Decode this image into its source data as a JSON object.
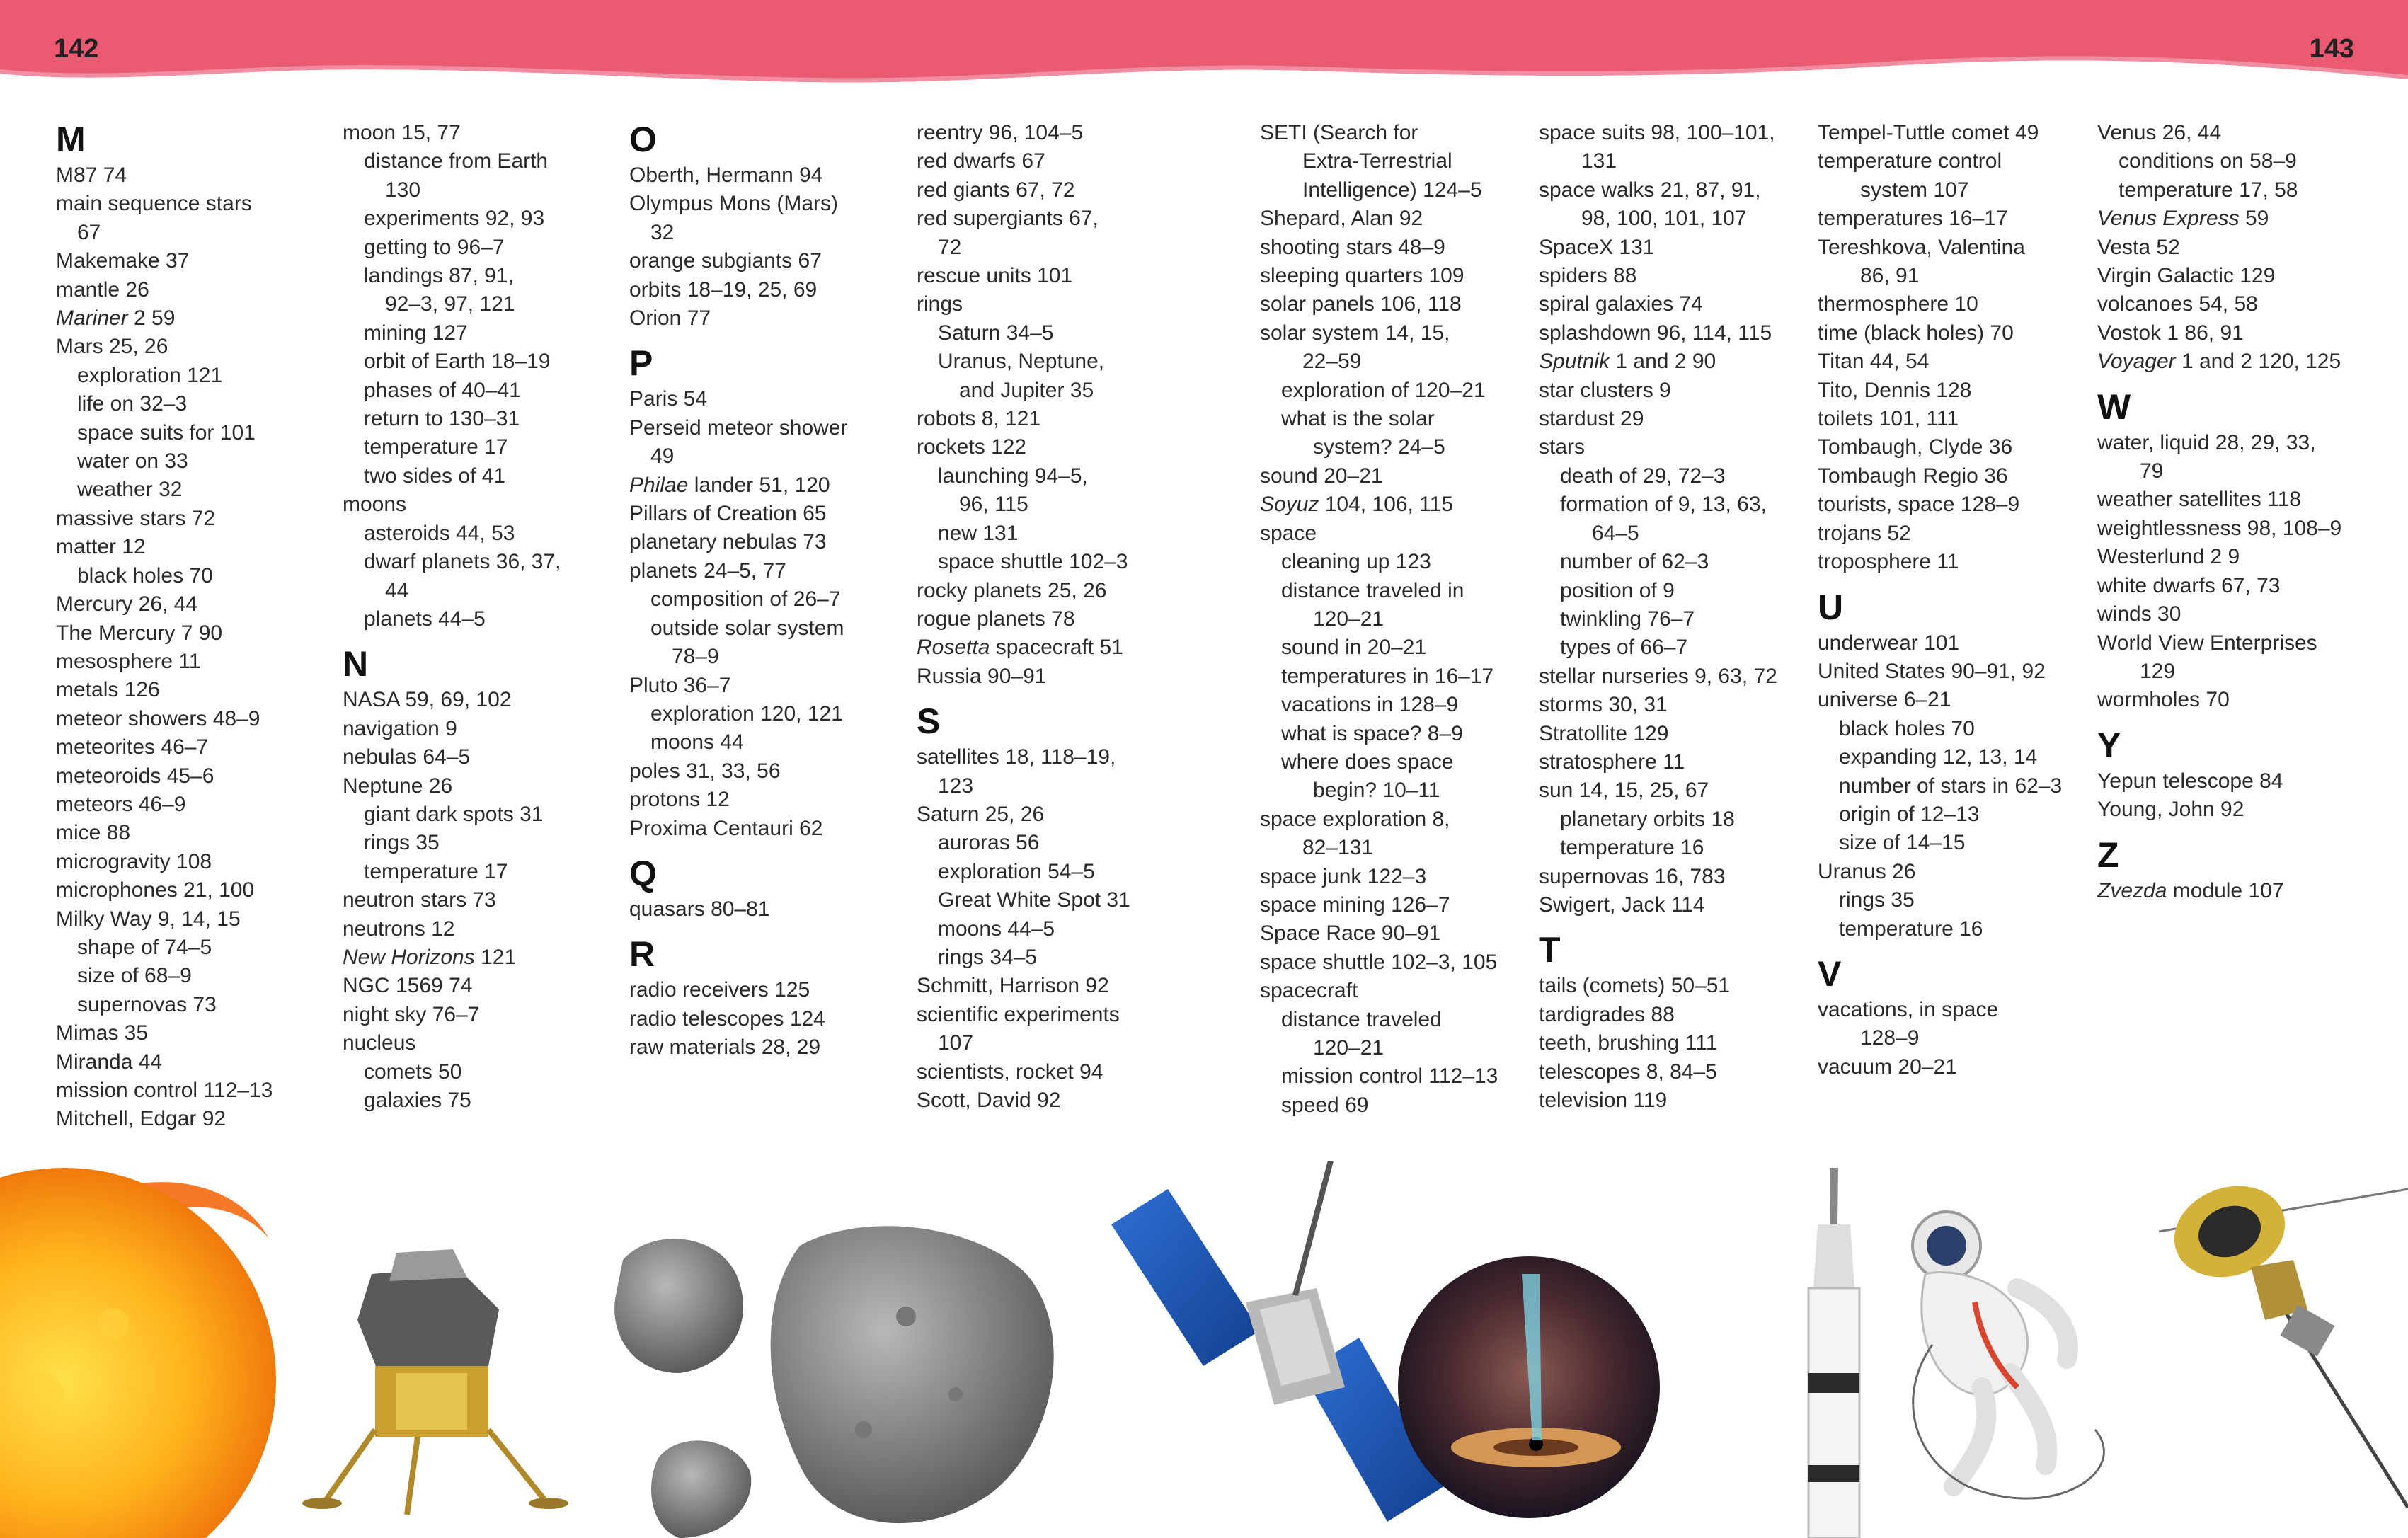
{
  "page_numbers": {
    "left": "142",
    "right": "143"
  },
  "colors": {
    "banner": "#EB5A73",
    "banner_light": "#F08DA0",
    "text": "#2a2a2a"
  },
  "columns": [
    [
      {
        "t": "h",
        "v": "M"
      },
      {
        "t": "e",
        "v": "M87 74"
      },
      {
        "t": "e",
        "v": "main sequence stars"
      },
      {
        "t": "c",
        "v": "67",
        "l": 2
      },
      {
        "t": "e",
        "v": "Makemake 37"
      },
      {
        "t": "e",
        "v": "mantle 26"
      },
      {
        "t": "e",
        "v": [
          [
            "Mariner",
            true
          ],
          [
            " 2 59",
            false
          ]
        ]
      },
      {
        "t": "e",
        "v": "Mars 25, 26"
      },
      {
        "t": "s",
        "v": "exploration 121"
      },
      {
        "t": "s",
        "v": "life on 32–3"
      },
      {
        "t": "s",
        "v": "space suits for 101"
      },
      {
        "t": "s",
        "v": "water on 33"
      },
      {
        "t": "s",
        "v": "weather 32"
      },
      {
        "t": "e",
        "v": "massive stars 72"
      },
      {
        "t": "e",
        "v": "matter 12"
      },
      {
        "t": "s",
        "v": "black holes 70"
      },
      {
        "t": "e",
        "v": "Mercury 26, 44"
      },
      {
        "t": "e",
        "v": "The Mercury 7 90"
      },
      {
        "t": "e",
        "v": "mesosphere 11"
      },
      {
        "t": "e",
        "v": "metals 126"
      },
      {
        "t": "e",
        "v": "meteor showers 48–9"
      },
      {
        "t": "e",
        "v": "meteorites 46–7"
      },
      {
        "t": "e",
        "v": "meteoroids 45–6"
      },
      {
        "t": "e",
        "v": "meteors 46–9"
      },
      {
        "t": "e",
        "v": "mice 88"
      },
      {
        "t": "e",
        "v": "microgravity 108"
      },
      {
        "t": "e",
        "v": "microphones 21, 100"
      },
      {
        "t": "e",
        "v": "Milky Way 9, 14, 15"
      },
      {
        "t": "s",
        "v": "shape of 74–5"
      },
      {
        "t": "s",
        "v": "size of 68–9"
      },
      {
        "t": "s",
        "v": "supernovas 73"
      },
      {
        "t": "e",
        "v": "Mimas 35"
      },
      {
        "t": "e",
        "v": "Miranda 44"
      },
      {
        "t": "e",
        "v": "mission control 112–13"
      },
      {
        "t": "e",
        "v": "Mitchell, Edgar 92"
      }
    ],
    [
      {
        "t": "e",
        "v": "moon 15, 77"
      },
      {
        "t": "s",
        "v": "distance from Earth"
      },
      {
        "t": "c",
        "v": "130",
        "l": 3
      },
      {
        "t": "s",
        "v": "experiments 92, 93"
      },
      {
        "t": "s",
        "v": "getting to 96–7"
      },
      {
        "t": "s",
        "v": "landings 87, 91,"
      },
      {
        "t": "c",
        "v": "92–3, 97, 121",
        "l": 3
      },
      {
        "t": "s",
        "v": "mining 127"
      },
      {
        "t": "s",
        "v": "orbit of Earth 18–19"
      },
      {
        "t": "s",
        "v": "phases of 40–41"
      },
      {
        "t": "s",
        "v": "return to 130–31"
      },
      {
        "t": "s",
        "v": "temperature 17"
      },
      {
        "t": "s",
        "v": "two sides of 41"
      },
      {
        "t": "e",
        "v": "moons"
      },
      {
        "t": "s",
        "v": "asteroids 44, 53"
      },
      {
        "t": "s",
        "v": "dwarf planets 36, 37,"
      },
      {
        "t": "c",
        "v": "44",
        "l": 3
      },
      {
        "t": "s",
        "v": "planets 44–5"
      },
      {
        "t": "h",
        "v": "N"
      },
      {
        "t": "e",
        "v": "NASA 59, 69, 102"
      },
      {
        "t": "e",
        "v": "navigation 9"
      },
      {
        "t": "e",
        "v": "nebulas 64–5"
      },
      {
        "t": "e",
        "v": "Neptune 26"
      },
      {
        "t": "s",
        "v": "giant dark spots 31"
      },
      {
        "t": "s",
        "v": "rings 35"
      },
      {
        "t": "s",
        "v": "temperature 17"
      },
      {
        "t": "e",
        "v": "neutron stars 73"
      },
      {
        "t": "e",
        "v": "neutrons 12"
      },
      {
        "t": "e",
        "v": [
          [
            "New Horizons",
            true
          ],
          [
            " 121",
            false
          ]
        ]
      },
      {
        "t": "e",
        "v": "NGC 1569 74"
      },
      {
        "t": "e",
        "v": "night sky 76–7"
      },
      {
        "t": "e",
        "v": "nucleus"
      },
      {
        "t": "s",
        "v": "comets 50"
      },
      {
        "t": "s",
        "v": "galaxies 75"
      }
    ],
    [
      {
        "t": "h",
        "v": "O"
      },
      {
        "t": "e",
        "v": "Oberth, Hermann 94"
      },
      {
        "t": "e",
        "v": "Olympus Mons (Mars)"
      },
      {
        "t": "c",
        "v": "32",
        "l": 2
      },
      {
        "t": "e",
        "v": "orange subgiants 67"
      },
      {
        "t": "e",
        "v": "orbits 18–19, 25, 69"
      },
      {
        "t": "e",
        "v": "Orion 77"
      },
      {
        "t": "h",
        "v": "P"
      },
      {
        "t": "e",
        "v": "Paris 54"
      },
      {
        "t": "e",
        "v": "Perseid meteor shower"
      },
      {
        "t": "c",
        "v": "49",
        "l": 2
      },
      {
        "t": "e",
        "v": [
          [
            "Philae",
            true
          ],
          [
            " lander 51, 120",
            false
          ]
        ]
      },
      {
        "t": "e",
        "v": "Pillars of Creation 65"
      },
      {
        "t": "e",
        "v": "planetary nebulas 73"
      },
      {
        "t": "e",
        "v": "planets 24–5, 77"
      },
      {
        "t": "s",
        "v": "composition of 26–7"
      },
      {
        "t": "s",
        "v": "outside solar system"
      },
      {
        "t": "c",
        "v": "78–9",
        "l": 3
      },
      {
        "t": "e",
        "v": "Pluto 36–7"
      },
      {
        "t": "s",
        "v": "exploration 120, 121"
      },
      {
        "t": "s",
        "v": "moons 44"
      },
      {
        "t": "e",
        "v": "poles 31, 33, 56"
      },
      {
        "t": "e",
        "v": "protons 12"
      },
      {
        "t": "e",
        "v": "Proxima Centauri 62"
      },
      {
        "t": "h",
        "v": "Q"
      },
      {
        "t": "e",
        "v": "quasars 80–81"
      },
      {
        "t": "h",
        "v": "R"
      },
      {
        "t": "e",
        "v": "radio receivers 125"
      },
      {
        "t": "e",
        "v": "radio telescopes 124"
      },
      {
        "t": "e",
        "v": "raw materials 28, 29"
      }
    ],
    [
      {
        "t": "e",
        "v": "reentry 96, 104–5"
      },
      {
        "t": "e",
        "v": "red dwarfs 67"
      },
      {
        "t": "e",
        "v": "red giants 67, 72"
      },
      {
        "t": "e",
        "v": "red supergiants 67,"
      },
      {
        "t": "c",
        "v": "72",
        "l": 2
      },
      {
        "t": "e",
        "v": "rescue units 101"
      },
      {
        "t": "e",
        "v": "rings"
      },
      {
        "t": "s",
        "v": "Saturn 34–5"
      },
      {
        "t": "s",
        "v": "Uranus, Neptune,"
      },
      {
        "t": "c",
        "v": "and Jupiter 35",
        "l": 3
      },
      {
        "t": "e",
        "v": "robots 8, 121"
      },
      {
        "t": "e",
        "v": "rockets 122"
      },
      {
        "t": "s",
        "v": "launching 94–5,"
      },
      {
        "t": "c",
        "v": "96, 115",
        "l": 3
      },
      {
        "t": "s",
        "v": "new 131"
      },
      {
        "t": "s",
        "v": "space shuttle 102–3"
      },
      {
        "t": "e",
        "v": "rocky planets 25, 26"
      },
      {
        "t": "e",
        "v": "rogue planets 78"
      },
      {
        "t": "e",
        "v": [
          [
            "Rosetta",
            true
          ],
          [
            " spacecraft 51",
            false
          ]
        ]
      },
      {
        "t": "e",
        "v": "Russia 90–91"
      },
      {
        "t": "h",
        "v": "S"
      },
      {
        "t": "e",
        "v": "satellites 18, 118–19,"
      },
      {
        "t": "c",
        "v": "123",
        "l": 2
      },
      {
        "t": "e",
        "v": "Saturn 25, 26"
      },
      {
        "t": "s",
        "v": "auroras 56"
      },
      {
        "t": "s",
        "v": "exploration 54–5"
      },
      {
        "t": "s",
        "v": "Great White Spot 31"
      },
      {
        "t": "s",
        "v": "moons 44–5"
      },
      {
        "t": "s",
        "v": "rings 34–5"
      },
      {
        "t": "e",
        "v": "Schmitt, Harrison 92"
      },
      {
        "t": "e",
        "v": "scientific experiments"
      },
      {
        "t": "c",
        "v": "107",
        "l": 2
      },
      {
        "t": "e",
        "v": "scientists, rocket 94"
      },
      {
        "t": "e",
        "v": "Scott, David 92"
      }
    ],
    [
      {
        "t": "e",
        "v": "SETI (Search for"
      },
      {
        "t": "c",
        "v": "Extra-Terrestrial",
        "l": 3
      },
      {
        "t": "c",
        "v": "Intelligence) 124–5",
        "l": 3
      },
      {
        "t": "e",
        "v": "Shepard, Alan 92"
      },
      {
        "t": "e",
        "v": "shooting stars 48–9"
      },
      {
        "t": "e",
        "v": "sleeping quarters 109"
      },
      {
        "t": "e",
        "v": "solar panels 106, 118"
      },
      {
        "t": "e",
        "v": "solar system 14, 15,"
      },
      {
        "t": "c",
        "v": "22–59",
        "l": 3
      },
      {
        "t": "s",
        "v": "exploration of 120–21"
      },
      {
        "t": "s",
        "v": "what is the solar"
      },
      {
        "t": "c",
        "v": "system? 24–5",
        "l": 4
      },
      {
        "t": "e",
        "v": "sound 20–21"
      },
      {
        "t": "e",
        "v": [
          [
            "Soyuz",
            true
          ],
          [
            " 104, 106, 115",
            false
          ]
        ]
      },
      {
        "t": "e",
        "v": "space"
      },
      {
        "t": "s",
        "v": "cleaning up 123"
      },
      {
        "t": "s",
        "v": "distance traveled in"
      },
      {
        "t": "c",
        "v": "120–21",
        "l": 4
      },
      {
        "t": "s",
        "v": "sound in 20–21"
      },
      {
        "t": "s",
        "v": "temperatures in 16–17"
      },
      {
        "t": "s",
        "v": "vacations in 128–9"
      },
      {
        "t": "s",
        "v": "what is space? 8–9"
      },
      {
        "t": "s",
        "v": "where does space"
      },
      {
        "t": "c",
        "v": "begin? 10–11",
        "l": 4
      },
      {
        "t": "e",
        "v": "space exploration 8,"
      },
      {
        "t": "c",
        "v": "82–131",
        "l": 3
      },
      {
        "t": "e",
        "v": "space junk 122–3"
      },
      {
        "t": "e",
        "v": "space mining 126–7"
      },
      {
        "t": "e",
        "v": "Space Race 90–91"
      },
      {
        "t": "e",
        "v": "space shuttle 102–3, 105"
      },
      {
        "t": "e",
        "v": "spacecraft"
      },
      {
        "t": "s",
        "v": "distance traveled"
      },
      {
        "t": "c",
        "v": "120–21",
        "l": 4
      },
      {
        "t": "s",
        "v": "mission control 112–13"
      },
      {
        "t": "s",
        "v": "speed 69"
      }
    ],
    [
      {
        "t": "e",
        "v": "space suits 98, 100–101,"
      },
      {
        "t": "c",
        "v": "131",
        "l": 3
      },
      {
        "t": "e",
        "v": "space walks 21, 87, 91,"
      },
      {
        "t": "c",
        "v": "98, 100, 101, 107",
        "l": 3
      },
      {
        "t": "e",
        "v": "SpaceX 131"
      },
      {
        "t": "e",
        "v": "spiders 88"
      },
      {
        "t": "e",
        "v": "spiral galaxies 74"
      },
      {
        "t": "e",
        "v": "splashdown 96, 114, 115"
      },
      {
        "t": "e",
        "v": [
          [
            "Sputnik",
            true
          ],
          [
            " 1 and 2 90",
            false
          ]
        ]
      },
      {
        "t": "e",
        "v": "star clusters 9"
      },
      {
        "t": "e",
        "v": "stardust 29"
      },
      {
        "t": "e",
        "v": "stars"
      },
      {
        "t": "s",
        "v": "death of 29, 72–3"
      },
      {
        "t": "s",
        "v": "formation of 9, 13, 63,"
      },
      {
        "t": "c",
        "v": "64–5",
        "l": 4
      },
      {
        "t": "s",
        "v": "number of 62–3"
      },
      {
        "t": "s",
        "v": "position of 9"
      },
      {
        "t": "s",
        "v": "twinkling 76–7"
      },
      {
        "t": "s",
        "v": "types of 66–7"
      },
      {
        "t": "e",
        "v": "stellar nurseries 9, 63, 72"
      },
      {
        "t": "e",
        "v": "storms 30, 31"
      },
      {
        "t": "e",
        "v": "Stratollite 129"
      },
      {
        "t": "e",
        "v": "stratosphere 11"
      },
      {
        "t": "e",
        "v": "sun 14, 15, 25, 67"
      },
      {
        "t": "s",
        "v": "planetary orbits 18"
      },
      {
        "t": "s",
        "v": "temperature 16"
      },
      {
        "t": "e",
        "v": "supernovas 16, 783"
      },
      {
        "t": "e",
        "v": "Swigert, Jack 114"
      },
      {
        "t": "h",
        "v": "T"
      },
      {
        "t": "e",
        "v": "tails (comets) 50–51"
      },
      {
        "t": "e",
        "v": "tardigrades 88"
      },
      {
        "t": "e",
        "v": "teeth, brushing 111"
      },
      {
        "t": "e",
        "v": "telescopes 8, 84–5"
      },
      {
        "t": "e",
        "v": "television 119"
      }
    ],
    [
      {
        "t": "e",
        "v": "Tempel-Tuttle comet 49"
      },
      {
        "t": "e",
        "v": "temperature control"
      },
      {
        "t": "c",
        "v": "system 107",
        "l": 3
      },
      {
        "t": "e",
        "v": "temperatures 16–17"
      },
      {
        "t": "e",
        "v": "Tereshkova, Valentina"
      },
      {
        "t": "c",
        "v": "86, 91",
        "l": 3
      },
      {
        "t": "e",
        "v": "thermosphere 10"
      },
      {
        "t": "e",
        "v": "time (black holes) 70"
      },
      {
        "t": "e",
        "v": "Titan 44, 54"
      },
      {
        "t": "e",
        "v": "Tito, Dennis 128"
      },
      {
        "t": "e",
        "v": "toilets 101, 111"
      },
      {
        "t": "e",
        "v": "Tombaugh, Clyde 36"
      },
      {
        "t": "e",
        "v": "Tombaugh Regio 36"
      },
      {
        "t": "e",
        "v": "tourists, space 128–9"
      },
      {
        "t": "e",
        "v": "trojans 52"
      },
      {
        "t": "e",
        "v": "troposphere 11"
      },
      {
        "t": "h",
        "v": "U"
      },
      {
        "t": "e",
        "v": "underwear 101"
      },
      {
        "t": "e",
        "v": "United States 90–91, 92"
      },
      {
        "t": "e",
        "v": "universe 6–21"
      },
      {
        "t": "s",
        "v": "black holes 70"
      },
      {
        "t": "s",
        "v": "expanding 12, 13, 14"
      },
      {
        "t": "s",
        "v": "number of stars in 62–3"
      },
      {
        "t": "s",
        "v": "origin of 12–13"
      },
      {
        "t": "s",
        "v": "size of 14–15"
      },
      {
        "t": "e",
        "v": "Uranus 26"
      },
      {
        "t": "s",
        "v": "rings 35"
      },
      {
        "t": "s",
        "v": "temperature 16"
      },
      {
        "t": "h",
        "v": "V"
      },
      {
        "t": "e",
        "v": "vacations, in space"
      },
      {
        "t": "c",
        "v": "128–9",
        "l": 3
      },
      {
        "t": "e",
        "v": "vacuum 20–21"
      }
    ],
    [
      {
        "t": "e",
        "v": "Venus 26, 44"
      },
      {
        "t": "s",
        "v": "conditions on 58–9"
      },
      {
        "t": "s",
        "v": "temperature 17, 58"
      },
      {
        "t": "e",
        "v": [
          [
            "Venus Express",
            true
          ],
          [
            " 59",
            false
          ]
        ]
      },
      {
        "t": "e",
        "v": "Vesta 52"
      },
      {
        "t": "e",
        "v": "Virgin Galactic 129"
      },
      {
        "t": "e",
        "v": "volcanoes 54, 58"
      },
      {
        "t": "e",
        "v": "Vostok 1 86, 91"
      },
      {
        "t": "e",
        "v": [
          [
            "Voyager",
            true
          ],
          [
            " 1 and 2 120, 125",
            false
          ]
        ]
      },
      {
        "t": "h",
        "v": "W"
      },
      {
        "t": "e",
        "v": "water, liquid 28, 29, 33,"
      },
      {
        "t": "c",
        "v": "79",
        "l": 3
      },
      {
        "t": "e",
        "v": "weather satellites 118"
      },
      {
        "t": "e",
        "v": "weightlessness 98, 108–9"
      },
      {
        "t": "e",
        "v": "Westerlund 2 9"
      },
      {
        "t": "e",
        "v": "white dwarfs 67, 73"
      },
      {
        "t": "e",
        "v": "winds 30"
      },
      {
        "t": "e",
        "v": "World View Enterprises"
      },
      {
        "t": "c",
        "v": "129",
        "l": 3
      },
      {
        "t": "e",
        "v": "wormholes 70"
      },
      {
        "t": "h",
        "v": "Y"
      },
      {
        "t": "e",
        "v": "Yepun telescope 84"
      },
      {
        "t": "e",
        "v": "Young, John 92"
      },
      {
        "t": "h",
        "v": "Z"
      },
      {
        "t": "e",
        "v": [
          [
            "Zvezda",
            true
          ],
          [
            " module 107",
            false
          ]
        ]
      }
    ]
  ],
  "images": [
    {
      "icon": "sun-icon"
    },
    {
      "icon": "lunar-module-icon"
    },
    {
      "icon": "asteroids-icon"
    },
    {
      "icon": "satellite-icon"
    },
    {
      "icon": "black-hole-icon"
    },
    {
      "icon": "rocket-icon"
    },
    {
      "icon": "astronaut-icon"
    },
    {
      "icon": "space-probe-icon"
    }
  ]
}
